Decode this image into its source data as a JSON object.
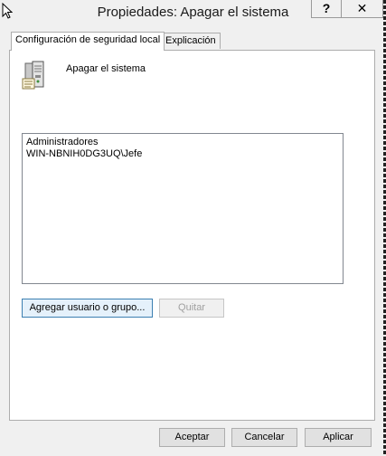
{
  "window": {
    "title": "Propiedades: Apagar el sistema"
  },
  "titlebar_buttons": {
    "help": "?",
    "close": "✕"
  },
  "tabs": [
    {
      "label": "Configuración de seguridad local",
      "active": true
    },
    {
      "label": "Explicación",
      "active": false
    }
  ],
  "policy": {
    "name": "Apagar el sistema",
    "icon": "server-icon"
  },
  "members": [
    "Administradores",
    "WIN-NBNIH0DG3UQ\\Jefe"
  ],
  "buttons": {
    "add": "Agregar usuario o grupo...",
    "remove": "Quitar",
    "ok": "Aceptar",
    "cancel": "Cancelar",
    "apply": "Aplicar"
  },
  "colors": {
    "focus_border": "#3c7fb1",
    "window_bg": "#f0f0f0"
  }
}
